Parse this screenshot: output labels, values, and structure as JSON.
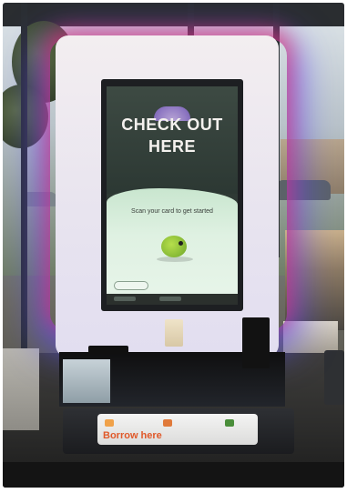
{
  "scene": "self-checkout-kiosk-photo",
  "kiosk": {
    "screen": {
      "headline_line1": "CHECK OUT",
      "headline_line2": "HERE",
      "prompt": "Scan your card to get started"
    },
    "tray_label": "Borrow  here"
  },
  "colors": {
    "glow_red": "#ff2850",
    "glow_blue": "#5a50ff",
    "screen_green": "#c9e6cf",
    "mascot_green": "#8bc53a",
    "label_orange": "#e0592a"
  }
}
